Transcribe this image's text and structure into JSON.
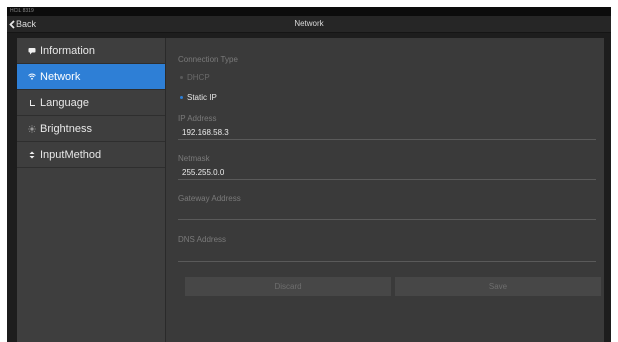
{
  "status_bar": {
    "text": "HCIL 8319"
  },
  "nav": {
    "back_label": "Back",
    "title": "Network"
  },
  "sidebar": {
    "items": [
      {
        "label": "Information",
        "icon": "comment-icon"
      },
      {
        "label": "Network",
        "icon": "wifi-icon",
        "selected": true
      },
      {
        "label": "Language",
        "icon": "language-icon"
      },
      {
        "label": "Brightness",
        "icon": "brightness-icon"
      },
      {
        "label": "InputMethod",
        "icon": "sort-icon"
      }
    ]
  },
  "form": {
    "connection_type_label": "Connection Type",
    "options": [
      {
        "label": "DHCP",
        "selected": false
      },
      {
        "label": "Static IP",
        "selected": true
      }
    ],
    "ip_label": "IP Address",
    "ip_value": "192.168.58.3",
    "netmask_label": "Netmask",
    "netmask_value": "255.255.0.0",
    "gateway_label": "Gateway Address",
    "gateway_value": "",
    "dns_label": "DNS Address",
    "dns_value": "",
    "discard_label": "Discard",
    "save_label": "Save"
  },
  "colors": {
    "accent": "#2e7fd6",
    "background": "#1d1d1d",
    "panel": "#3a3a3a",
    "sidebar": "#3e3e3e"
  }
}
